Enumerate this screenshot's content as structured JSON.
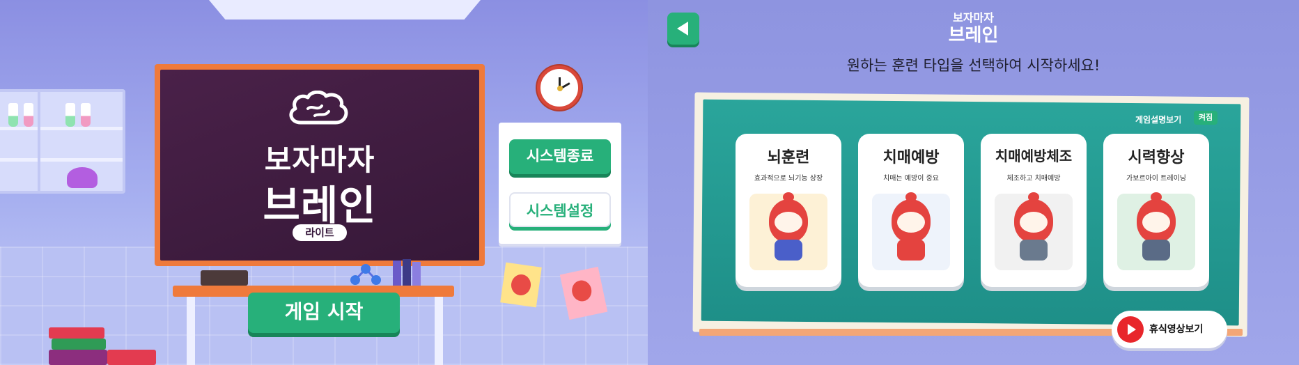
{
  "left_screen": {
    "logo_line1": "보자마자",
    "logo_line2": "브레인",
    "edition_badge": "라이트",
    "exit_button": "시스템종료",
    "settings_button": "시스템설정",
    "start_button": "게임 시작"
  },
  "right_screen": {
    "logo_line1": "보자마자",
    "logo_line2": "브레인",
    "subtitle": "원하는 훈련 타입을 선택하여 시작하세요!",
    "guide_label": "게임설명보기",
    "guide_toggle": "켜짐",
    "cards": [
      {
        "title": "뇌훈련",
        "desc": "효과적으로 뇌기능 상장",
        "pic_color": "#fdf1d6"
      },
      {
        "title": "치매예방",
        "desc": "치매는 예방이 중요",
        "pic_color": "#eef3fb"
      },
      {
        "title": "치매예방체조",
        "desc": "체조하고 치매예방",
        "pic_color": "#f1f1f1"
      },
      {
        "title": "시력향상",
        "desc": "가보르아이 트레이닝",
        "pic_color": "#dff1e4"
      }
    ],
    "rest_button": "휴식영상보기"
  },
  "colors": {
    "accent_green": "#27b07a",
    "board_purple": "#3f1c40",
    "board_frame_orange": "#ef7a3b",
    "board_teal": "#2aa59b",
    "mascot_red": "#e4433f"
  }
}
